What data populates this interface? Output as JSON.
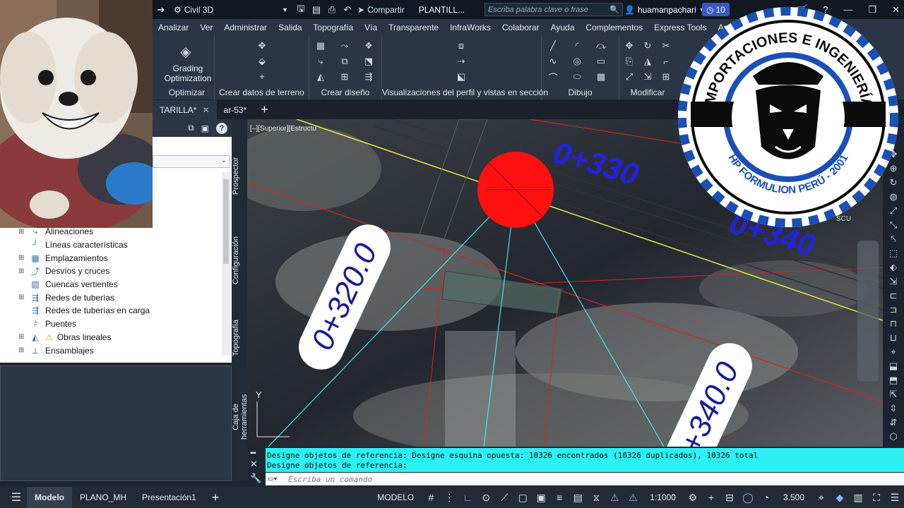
{
  "titlebar": {
    "workspace": "Civil 3D",
    "share_label": "Compartir",
    "doc_title": "PLANTILL...",
    "search_placeholder": "Escriba palabra clave o frase",
    "username": "huamanpachari",
    "notification_count": "10"
  },
  "menubar": {
    "items": [
      "Analizar",
      "Ver",
      "Administrar",
      "Salida",
      "Topografía",
      "Vía",
      "Transparente",
      "InfraWorks",
      "Colaborar",
      "Ayuda",
      "Complementos",
      "Express Tools",
      "Ap"
    ]
  },
  "ribbon": {
    "grading_label_line1": "Grading",
    "grading_label_line2": "Optimization",
    "panels": [
      "Optimizar",
      "Crear datos de terreno",
      "Crear diseño",
      "Visualizaciones del perfil y vistas en sección",
      "Dibujo",
      "Modificar"
    ]
  },
  "doctabs": {
    "tabs": [
      "TARILLA*",
      "ar-53*"
    ],
    "new_tab": "+"
  },
  "prospector": {
    "tree_items": [
      "Alineaciones",
      "Líneas características",
      "Emplazamientos",
      "Desvíos y cruces",
      "Cuencas vertientes",
      "Redes de tuberías",
      "Redes de tuberías en carga",
      "Puentes",
      "Obras lineales",
      "Ensamblajes"
    ]
  },
  "sidetabs": [
    "Prospector",
    "Configuración",
    "Topografía",
    "Caja de herramientas"
  ],
  "viewport": {
    "view_label": "[–][Superior][Estructu",
    "stations": [
      "0+330",
      "0+340",
      "0+320.0",
      "0+340.0"
    ],
    "axis_y": "Y",
    "compass_label": "SCU"
  },
  "command": {
    "history_line1": "Designe objetos de referencia: Designe esquina opuesta: 10326 encontrados (10326 duplicados), 10326 total",
    "history_line2": "Designe objetos de referencia:",
    "placeholder": "Escriba un comando"
  },
  "statusbar": {
    "tabs": [
      "Modelo",
      "PLANO_MH",
      "Presentación1"
    ],
    "add": "+",
    "mode": "MODELO",
    "scale": "1:1000",
    "value": "3.500"
  },
  "logo": {
    "top_text": "IMPORTACIONES E INGENIERÍA",
    "bottom_text": "HP FORMULION PERÚ - 2001",
    "colors": {
      "blue": "#1a4fb5",
      "black": "#0b0b0b",
      "white": "#ffffff"
    }
  },
  "colors": {
    "accent_cyan": "#2ef0f4",
    "station_blue": "#2222dd",
    "marker_red": "#ff1010"
  }
}
